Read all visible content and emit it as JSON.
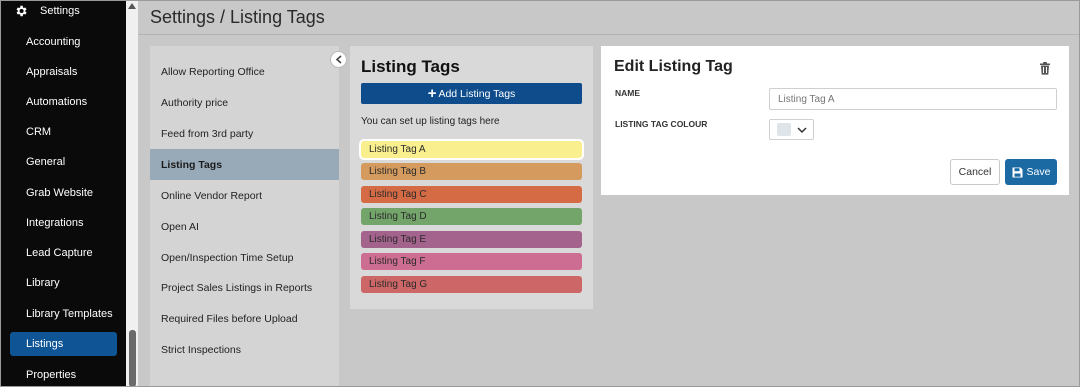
{
  "page": {
    "title": "Settings / Listing Tags"
  },
  "nav": {
    "header_label": "Settings",
    "items": [
      {
        "label": "Accounting"
      },
      {
        "label": "Appraisals"
      },
      {
        "label": "Automations"
      },
      {
        "label": "CRM"
      },
      {
        "label": "General"
      },
      {
        "label": "Grab Website"
      },
      {
        "label": "Integrations"
      },
      {
        "label": "Lead Capture"
      },
      {
        "label": "Library"
      },
      {
        "label": "Library Templates"
      },
      {
        "label": "Listings",
        "active": true
      },
      {
        "label": "Properties"
      }
    ],
    "active_color": "#0f5596"
  },
  "settings_list": {
    "items": [
      {
        "label": "Allow Reporting Office"
      },
      {
        "label": "Authority price"
      },
      {
        "label": "Feed from 3rd party"
      },
      {
        "label": "Listing Tags",
        "active": true
      },
      {
        "label": "Online Vendor Report"
      },
      {
        "label": "Open AI"
      },
      {
        "label": "Open/Inspection Time Setup"
      },
      {
        "label": "Project Sales Listings in Reports"
      },
      {
        "label": "Required Files before Upload"
      },
      {
        "label": "Strict Inspections"
      }
    ]
  },
  "listing_tags": {
    "title": "Listing Tags",
    "add_button_label": "Add Listing Tags",
    "help_text": "You can set up listing tags here",
    "tags": [
      {
        "label": "Listing Tag A",
        "color": "#f9ef8f",
        "selected": true
      },
      {
        "label": "Listing Tag B",
        "color": "#d49a5e"
      },
      {
        "label": "Listing Tag C",
        "color": "#d56b45"
      },
      {
        "label": "Listing Tag D",
        "color": "#73a56a"
      },
      {
        "label": "Listing Tag E",
        "color": "#a3638d"
      },
      {
        "label": "Listing Tag F",
        "color": "#cd6d91"
      },
      {
        "label": "Listing Tag G",
        "color": "#cd6767"
      }
    ]
  },
  "edit_panel": {
    "title": "Edit Listing Tag",
    "name_label": "NAME",
    "name_placeholder": "Listing Tag A",
    "colour_label": "LISTING TAG COLOUR",
    "colour_value": "#dfe4ea",
    "cancel_label": "Cancel",
    "save_label": "Save"
  },
  "icons": {
    "settings": "gear-icon",
    "add": "plus-icon",
    "delete": "trash-icon",
    "collapse": "chevron-left-icon",
    "dropdown": "chevron-down-icon",
    "save": "floppy-disk-icon"
  }
}
